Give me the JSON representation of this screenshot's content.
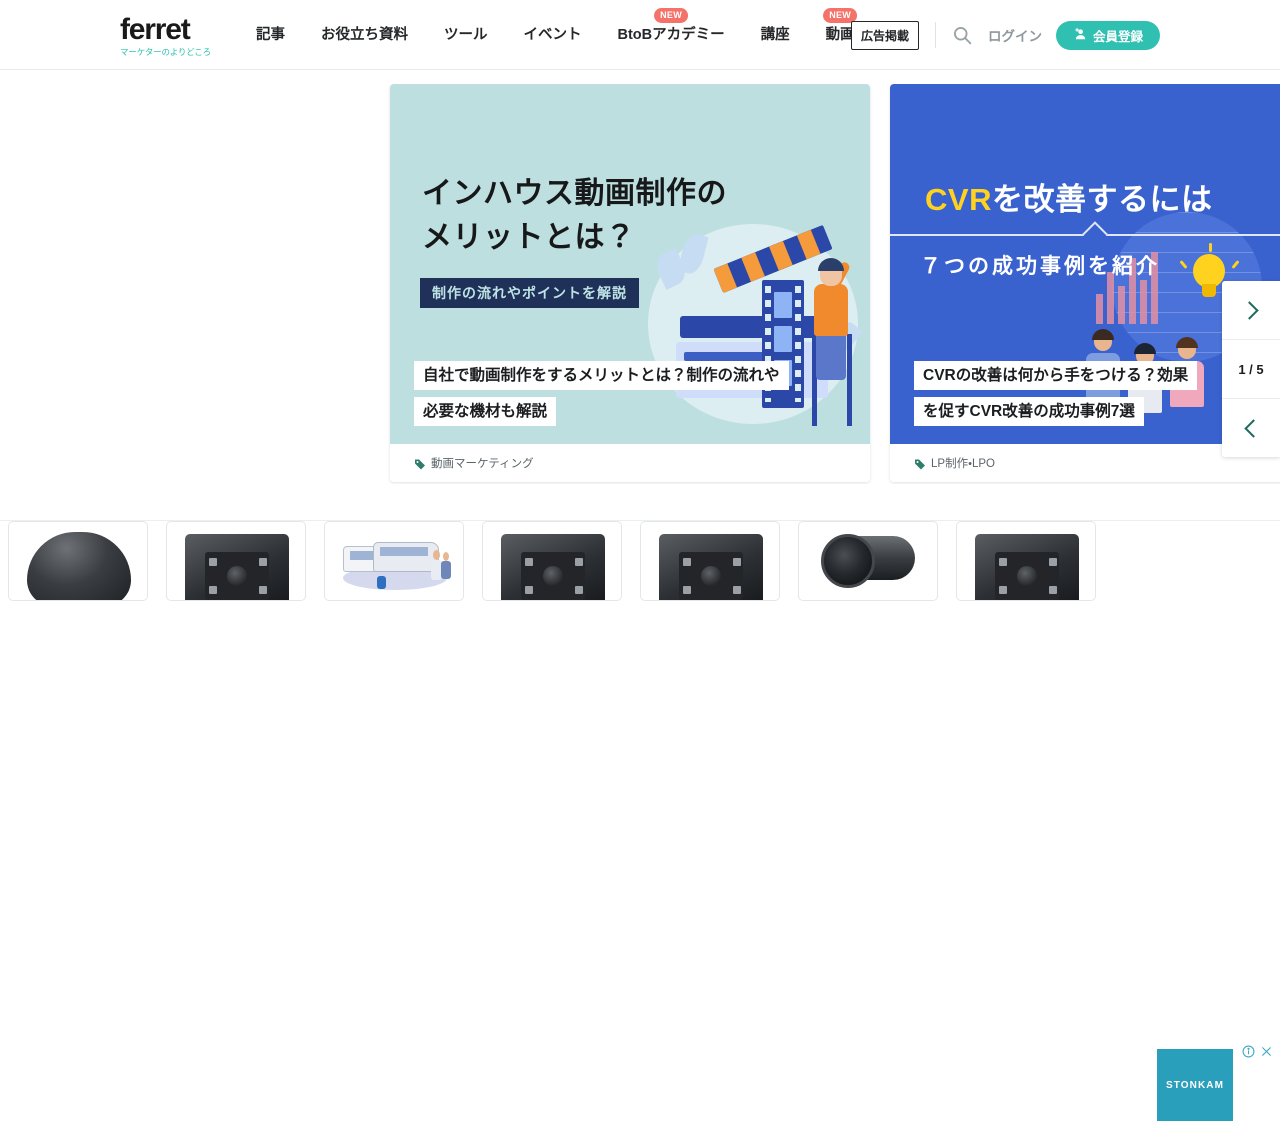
{
  "header": {
    "logo": {
      "name": "ferret",
      "tagline": "マーケターのよりどころ"
    },
    "nav": [
      {
        "label": "記事",
        "badge": null
      },
      {
        "label": "お役立ち資料",
        "badge": null
      },
      {
        "label": "ツール",
        "badge": null
      },
      {
        "label": "イベント",
        "badge": null
      },
      {
        "label": "BtoBアカデミー",
        "badge": "NEW"
      },
      {
        "label": "講座",
        "badge": null
      },
      {
        "label": "動画",
        "badge": "NEW"
      }
    ],
    "ad_button": "広告掲載",
    "search_icon": "search-icon",
    "login": "ログイン",
    "signup": "会員登録",
    "accent_color": "#2fc0b2",
    "badge_color": "#f4726a"
  },
  "carousel": {
    "counter": "1 / 5",
    "next_icon": "chevron-right-icon",
    "prev_icon": "chevron-left-icon",
    "slides": [
      {
        "hero_line1": "インハウス動画制作の",
        "hero_line2": "メリットとは？",
        "hero_badge": "制作の流れやポイントを解説",
        "title_line1": "自社で動画制作をするメリットとは？制作の流れや",
        "title_line2": "必要な機材も解説",
        "tag": "動画マーケティング",
        "bg_color": "#bedfe0"
      },
      {
        "hero_highlight": "CVR",
        "hero_rest": "を改善するには",
        "hero_sub": "７つの成功事例を紹介",
        "title_line1": "CVRの改善は何から手をつける？効果",
        "title_line2": "を促すCVR改善の成功事例7選",
        "tag": "LP制作・LPO",
        "bg_color": "#3a62cf",
        "highlight_color": "#ffd21f"
      }
    ]
  },
  "ad_strip": {
    "brand": "STONKAM",
    "brand_color": "#2a9fbc",
    "info_icon": "info-icon",
    "close_icon": "close-icon",
    "tiles": [
      {
        "alt": "dome-camera"
      },
      {
        "alt": "box-camera"
      },
      {
        "alt": "bus-illustration"
      },
      {
        "alt": "box-camera"
      },
      {
        "alt": "box-camera"
      },
      {
        "alt": "bullet-camera"
      },
      {
        "alt": "box-camera"
      }
    ]
  }
}
